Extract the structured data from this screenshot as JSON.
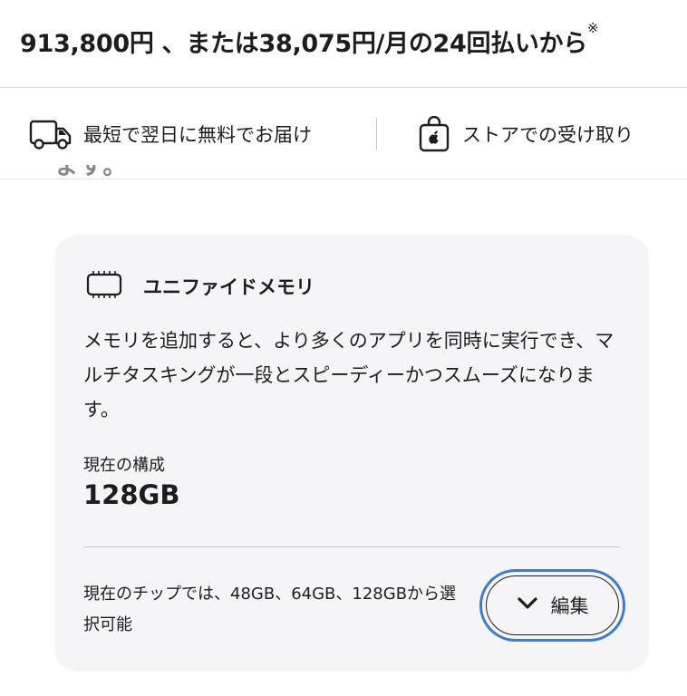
{
  "price": {
    "text": "913,800円 、または38,075円/月の24回払いから",
    "note": "※"
  },
  "delivery": {
    "shipping_label": "最短で翌日に無料でお届け",
    "pickup_label": "ストアでの受け取り",
    "icons": [
      "truck-icon",
      "apple-bag-icon"
    ]
  },
  "partial_text": "ます。",
  "memory_card": {
    "icon": "memory-chip-icon",
    "title": "ユニファイドメモリ",
    "description": "メモリを追加すると、より多くのアプリを同時に実行でき、マルチタスキングが一段とスピーディーかつスムーズになります。",
    "current_label": "現在の構成",
    "current_value": "128GB",
    "availability": "現在のチップでは、48GB、64GB、128GBから選択可能",
    "edit_label": "編集",
    "edit_icon": "chevron-down-icon"
  },
  "colors": {
    "focus_ring": "#3a7bd5",
    "card_bg": "#f5f5f7",
    "text": "#1d1d1f"
  }
}
